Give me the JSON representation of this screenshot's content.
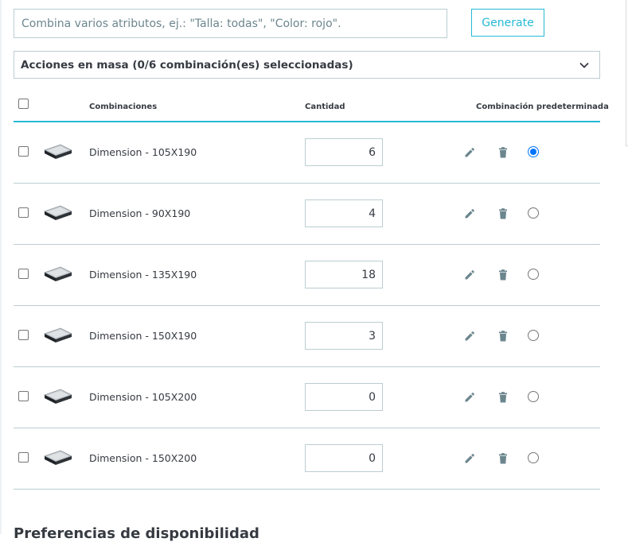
{
  "attributes": {
    "placeholder": "Combina varios atributos, ej.: \"Talla: todas\", \"Color: rojo\"."
  },
  "generate_label": "Generate",
  "bulk_actions_label": "Acciones en masa (0/6 combinación(es) seleccionadas)",
  "table": {
    "headers": {
      "combinations": "Combinaciones",
      "quantity": "Cantidad",
      "default": "Combinación predeterminada"
    },
    "rows": [
      {
        "name": "Dimension - 105X190",
        "quantity": "6",
        "default": true
      },
      {
        "name": "Dimension - 90X190",
        "quantity": "4",
        "default": false
      },
      {
        "name": "Dimension - 135X190",
        "quantity": "18",
        "default": false
      },
      {
        "name": "Dimension - 150X190",
        "quantity": "3",
        "default": false
      },
      {
        "name": "Dimension - 105X200",
        "quantity": "0",
        "default": false
      },
      {
        "name": "Dimension - 150X200",
        "quantity": "0",
        "default": false
      }
    ]
  },
  "next_section_heading": "Preferencias de disponibilidad",
  "icons": {
    "row_actions": [
      "pencil-icon",
      "trash-icon"
    ],
    "bulk_dropdown": "chevron-down-icon",
    "thumbnail": "mattress-image"
  },
  "colors": {
    "accent": "#25b9d7",
    "radio_selected": "#0075ff",
    "border": "#bbcdd2",
    "text": "#363a41",
    "icon": "#6c868e"
  }
}
